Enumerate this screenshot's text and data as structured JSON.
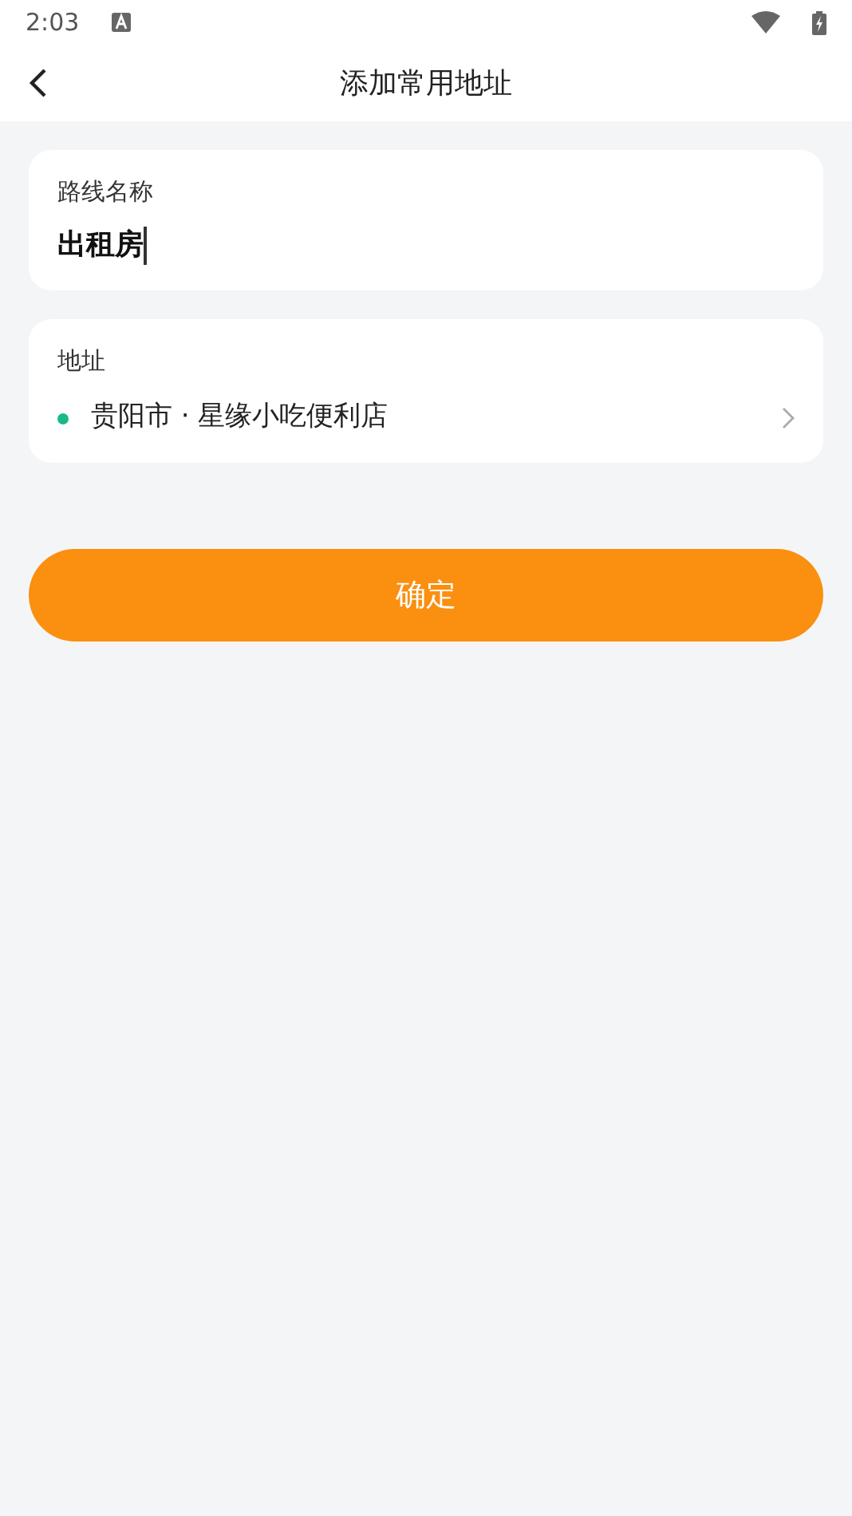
{
  "status_bar": {
    "time": "2:03"
  },
  "header": {
    "title": "添加常用地址"
  },
  "route_name": {
    "label": "路线名称",
    "value": "出租房"
  },
  "address": {
    "label": "地址",
    "value": "贵阳市 · 星缘小吃便利店"
  },
  "confirm_button": {
    "label": "确定"
  }
}
